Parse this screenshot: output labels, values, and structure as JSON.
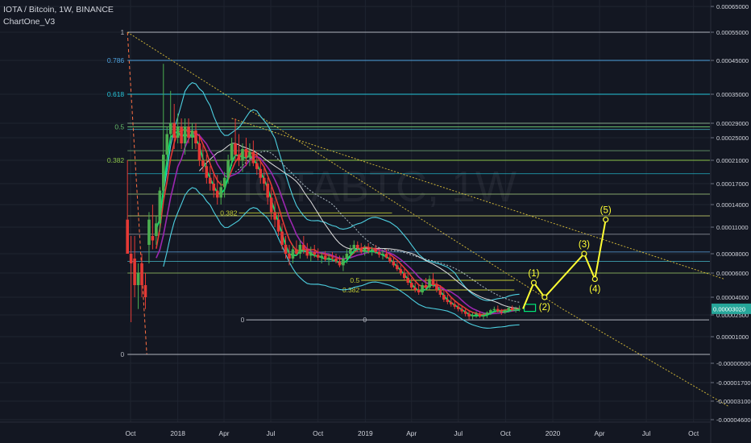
{
  "header": {
    "title": "IOTA / Bitcoin, 1W, BINANCE",
    "indicator": "ChartOne_V3"
  },
  "watermark": "IOTABTC, 1W",
  "price_marker": "0.00003020",
  "colors": {
    "background": "#131722",
    "grid": "#1f2430",
    "up": "#4caf50",
    "down": "#e53935",
    "wave": "#ffff33",
    "price_marker": "#26a69a"
  },
  "chart_data": {
    "type": "candlestick",
    "x_tick_labels": [
      "Oct",
      "2018",
      "Apr",
      "Jul",
      "Oct",
      "2019",
      "Apr",
      "Jul",
      "Oct",
      "2020",
      "Apr",
      "Jul",
      "Oct"
    ],
    "y_tick_labels": [
      "0.00065000",
      "0.00055000",
      "0.00045000",
      "0.00035000",
      "0.00029000",
      "0.00025000",
      "0.00021000",
      "0.00017000",
      "0.00014000",
      "0.00011000",
      "0.00008000",
      "0.00006000",
      "0.00004000",
      "0.00002500",
      "0.00001000",
      "-0.00000500",
      "-0.00001700",
      "-0.00003100",
      "-0.00004600"
    ],
    "y_tick_values": [
      0.00065,
      0.00055,
      0.00045,
      0.00035,
      0.00029,
      0.00025,
      0.00021,
      0.00017,
      0.00014,
      0.00011,
      8e-05,
      6e-05,
      4e-05,
      2.5e-05,
      1e-05,
      -5e-06,
      -1.7e-05,
      -3.1e-05,
      -4.6e-05
    ],
    "candles": [
      {
        "t": "2017-09-25",
        "o": 0.00012,
        "h": 0.00021,
        "l": 8e-05,
        "c": 8e-05
      },
      {
        "t": "2017-10-02",
        "o": 8e-05,
        "h": 0.0001,
        "l": 2e-05,
        "c": 7e-05
      },
      {
        "t": "2017-10-09",
        "o": 7.5e-05,
        "h": 0.0001,
        "l": 4e-05,
        "c": 5e-05
      },
      {
        "t": "2017-10-16",
        "o": 5e-05,
        "h": 7e-05,
        "l": 3e-05,
        "c": 6e-05
      },
      {
        "t": "2017-10-23",
        "o": 7e-05,
        "h": 8e-05,
        "l": 4e-05,
        "c": 5e-05
      },
      {
        "t": "2017-10-30",
        "o": 5e-05,
        "h": 6e-05,
        "l": 3e-05,
        "c": 4e-05
      },
      {
        "t": "2017-11-06",
        "o": 9e-05,
        "h": 0.00013,
        "l": 7e-05,
        "c": 0.00012
      },
      {
        "t": "2017-11-13",
        "o": 0.0001,
        "h": 0.00014,
        "l": 8.5e-05,
        "c": 9.5e-05
      },
      {
        "t": "2017-11-20",
        "o": 0.0001,
        "h": 0.000125,
        "l": 9e-05,
        "c": 0.000115
      },
      {
        "t": "2017-11-27",
        "o": 0.000115,
        "h": 0.000165,
        "l": 0.000105,
        "c": 0.00016
      },
      {
        "t": "2017-12-04",
        "o": 0.00016,
        "h": 0.00044,
        "l": 0.00015,
        "c": 0.00022
      },
      {
        "t": "2017-12-11",
        "o": 0.00022,
        "h": 0.00028,
        "l": 0.0002,
        "c": 0.00026
      },
      {
        "t": "2017-12-18",
        "o": 0.00026,
        "h": 0.00036,
        "l": 0.00024,
        "c": 0.00029
      },
      {
        "t": "2017-12-25",
        "o": 0.00029,
        "h": 0.00033,
        "l": 0.00023,
        "c": 0.00025
      },
      {
        "t": "2018-01-01",
        "o": 0.00025,
        "h": 0.00031,
        "l": 0.00024,
        "c": 0.00028
      },
      {
        "t": "2018-01-08",
        "o": 0.00028,
        "h": 0.0003,
        "l": 0.00023,
        "c": 0.00024
      },
      {
        "t": "2018-01-15",
        "o": 0.00024,
        "h": 0.0003,
        "l": 0.00022,
        "c": 0.00028
      },
      {
        "t": "2018-01-22",
        "o": 0.00028,
        "h": 0.0003,
        "l": 0.00024,
        "c": 0.00025
      },
      {
        "t": "2018-01-29",
        "o": 0.00025,
        "h": 0.00029,
        "l": 0.00023,
        "c": 0.00027
      },
      {
        "t": "2018-02-05",
        "o": 0.00027,
        "h": 0.00029,
        "l": 0.00023,
        "c": 0.00024
      },
      {
        "t": "2018-02-12",
        "o": 0.00024,
        "h": 0.00026,
        "l": 0.0002,
        "c": 0.00021
      },
      {
        "t": "2018-02-19",
        "o": 0.00021,
        "h": 0.00024,
        "l": 0.00019,
        "c": 0.0002
      },
      {
        "t": "2018-02-26",
        "o": 0.0002,
        "h": 0.00022,
        "l": 0.00017,
        "c": 0.00018
      },
      {
        "t": "2018-03-05",
        "o": 0.00018,
        "h": 0.0002,
        "l": 0.00016,
        "c": 0.00017
      },
      {
        "t": "2018-03-12",
        "o": 0.00017,
        "h": 0.00019,
        "l": 0.00015,
        "c": 0.00016
      },
      {
        "t": "2018-03-19",
        "o": 0.00016,
        "h": 0.000185,
        "l": 0.00014,
        "c": 0.00015
      },
      {
        "t": "2018-03-26",
        "o": 0.00015,
        "h": 0.000175,
        "l": 0.00014,
        "c": 0.000165
      },
      {
        "t": "2018-04-02",
        "o": 0.000165,
        "h": 0.00019,
        "l": 0.00015,
        "c": 0.00018
      },
      {
        "t": "2018-04-09",
        "o": 0.00018,
        "h": 0.00022,
        "l": 0.00017,
        "c": 0.00021
      },
      {
        "t": "2018-04-16",
        "o": 0.00021,
        "h": 0.00025,
        "l": 0.0002,
        "c": 0.00024
      },
      {
        "t": "2018-04-23",
        "o": 0.00024,
        "h": 0.0003,
        "l": 0.00021,
        "c": 0.00022
      },
      {
        "t": "2018-04-30",
        "o": 0.00022,
        "h": 0.00026,
        "l": 0.0002,
        "c": 0.00021
      },
      {
        "t": "2018-05-07",
        "o": 0.00021,
        "h": 0.00024,
        "l": 0.00019,
        "c": 0.00023
      },
      {
        "t": "2018-05-14",
        "o": 0.00023,
        "h": 0.00025,
        "l": 0.0002,
        "c": 0.000215
      },
      {
        "t": "2018-05-21",
        "o": 0.000215,
        "h": 0.00024,
        "l": 0.0002,
        "c": 0.000225
      },
      {
        "t": "2018-05-28",
        "o": 0.000225,
        "h": 0.000245,
        "l": 0.0002,
        "c": 0.000205
      },
      {
        "t": "2018-06-04",
        "o": 0.000205,
        "h": 0.000225,
        "l": 0.000185,
        "c": 0.000195
      },
      {
        "t": "2018-06-11",
        "o": 0.000195,
        "h": 0.00021,
        "l": 0.00017,
        "c": 0.00018
      },
      {
        "t": "2018-06-18",
        "o": 0.00018,
        "h": 0.0002,
        "l": 0.00016,
        "c": 0.00017
      },
      {
        "t": "2018-06-25",
        "o": 0.00017,
        "h": 0.00018,
        "l": 0.00014,
        "c": 0.00015
      },
      {
        "t": "2018-07-02",
        "o": 0.00015,
        "h": 0.000165,
        "l": 0.00012,
        "c": 0.00013
      },
      {
        "t": "2018-07-09",
        "o": 0.00013,
        "h": 0.000145,
        "l": 0.00011,
        "c": 0.00012
      },
      {
        "t": "2018-07-16",
        "o": 0.00012,
        "h": 0.00013,
        "l": 0.0001,
        "c": 0.000105
      },
      {
        "t": "2018-07-23",
        "o": 0.000105,
        "h": 0.000115,
        "l": 8.5e-05,
        "c": 9e-05
      },
      {
        "t": "2018-07-30",
        "o": 9e-05,
        "h": 0.0001,
        "l": 7.5e-05,
        "c": 8e-05
      },
      {
        "t": "2018-08-06",
        "o": 8e-05,
        "h": 9e-05,
        "l": 6.8e-05,
        "c": 7.5e-05
      },
      {
        "t": "2018-08-13",
        "o": 7.5e-05,
        "h": 9e-05,
        "l": 7e-05,
        "c": 8.5e-05
      },
      {
        "t": "2018-08-20",
        "o": 8.5e-05,
        "h": 9.5e-05,
        "l": 7.8e-05,
        "c": 8e-05
      },
      {
        "t": "2018-08-27",
        "o": 8e-05,
        "h": 9.5e-05,
        "l": 7.5e-05,
        "c": 9e-05
      },
      {
        "t": "2018-09-03",
        "o": 9e-05,
        "h": 0.0001,
        "l": 8e-05,
        "c": 8.5e-05
      },
      {
        "t": "2018-09-10",
        "o": 8.5e-05,
        "h": 9.2e-05,
        "l": 7.5e-05,
        "c": 7.8e-05
      },
      {
        "t": "2018-09-17",
        "o": 7.8e-05,
        "h": 8.8e-05,
        "l": 7.2e-05,
        "c": 8.2e-05
      },
      {
        "t": "2018-09-24",
        "o": 8.2e-05,
        "h": 9e-05,
        "l": 7.6e-05,
        "c": 7.9e-05
      },
      {
        "t": "2018-10-01",
        "o": 7.9e-05,
        "h": 8.6e-05,
        "l": 7.3e-05,
        "c": 7.6e-05
      },
      {
        "t": "2018-10-08",
        "o": 7.6e-05,
        "h": 8.2e-05,
        "l": 7e-05,
        "c": 7.8e-05
      },
      {
        "t": "2018-10-15",
        "o": 7.8e-05,
        "h": 8.3e-05,
        "l": 7.2e-05,
        "c": 7.4e-05
      },
      {
        "t": "2018-10-22",
        "o": 7.4e-05,
        "h": 8e-05,
        "l": 6.8e-05,
        "c": 7.6e-05
      },
      {
        "t": "2018-10-29",
        "o": 7.6e-05,
        "h": 8.2e-05,
        "l": 7.2e-05,
        "c": 7.5e-05
      },
      {
        "t": "2018-11-05",
        "o": 7.5e-05,
        "h": 8e-05,
        "l": 7e-05,
        "c": 7.2e-05
      },
      {
        "t": "2018-11-12",
        "o": 7.2e-05,
        "h": 7.8e-05,
        "l": 6.6e-05,
        "c": 6.8e-05
      },
      {
        "t": "2018-11-19",
        "o": 6.8e-05,
        "h": 7.8e-05,
        "l": 6.2e-05,
        "c": 7.5e-05
      },
      {
        "t": "2018-11-26",
        "o": 7.5e-05,
        "h": 8.5e-05,
        "l": 7e-05,
        "c": 8e-05
      },
      {
        "t": "2018-12-03",
        "o": 8e-05,
        "h": 9e-05,
        "l": 7.5e-05,
        "c": 8.5e-05
      },
      {
        "t": "2018-12-10",
        "o": 8.5e-05,
        "h": 9.5e-05,
        "l": 8e-05,
        "c": 9e-05
      },
      {
        "t": "2018-12-17",
        "o": 9e-05,
        "h": 9.4e-05,
        "l": 8.2e-05,
        "c": 8.6e-05
      },
      {
        "t": "2018-12-24",
        "o": 8.6e-05,
        "h": 9.2e-05,
        "l": 8e-05,
        "c": 8.2e-05
      },
      {
        "t": "2018-12-31",
        "o": 8.2e-05,
        "h": 9e-05,
        "l": 7.8e-05,
        "c": 8.6e-05
      },
      {
        "t": "2019-01-07",
        "o": 8.6e-05,
        "h": 9.2e-05,
        "l": 8e-05,
        "c": 8.3e-05
      },
      {
        "t": "2019-01-14",
        "o": 8.3e-05,
        "h": 8.8e-05,
        "l": 7.8e-05,
        "c": 8.5e-05
      },
      {
        "t": "2019-01-21",
        "o": 8.5e-05,
        "h": 9e-05,
        "l": 8e-05,
        "c": 8.2e-05
      },
      {
        "t": "2019-01-28",
        "o": 8.2e-05,
        "h": 8.6e-05,
        "l": 7.6e-05,
        "c": 7.9e-05
      },
      {
        "t": "2019-02-04",
        "o": 7.9e-05,
        "h": 8.4e-05,
        "l": 7.4e-05,
        "c": 8e-05
      },
      {
        "t": "2019-02-11",
        "o": 8e-05,
        "h": 8.5e-05,
        "l": 7.5e-05,
        "c": 7.6e-05
      },
      {
        "t": "2019-02-18",
        "o": 7.6e-05,
        "h": 8e-05,
        "l": 7e-05,
        "c": 7.2e-05
      },
      {
        "t": "2019-02-25",
        "o": 7.2e-05,
        "h": 7.6e-05,
        "l": 6.6e-05,
        "c": 6.8e-05
      },
      {
        "t": "2019-03-04",
        "o": 6.8e-05,
        "h": 7.2e-05,
        "l": 6.2e-05,
        "c": 6.4e-05
      },
      {
        "t": "2019-03-11",
        "o": 6.4e-05,
        "h": 6.8e-05,
        "l": 5.8e-05,
        "c": 6e-05
      },
      {
        "t": "2019-03-18",
        "o": 6e-05,
        "h": 6.4e-05,
        "l": 5.4e-05,
        "c": 5.6e-05
      },
      {
        "t": "2019-03-25",
        "o": 5.6e-05,
        "h": 6e-05,
        "l": 5e-05,
        "c": 5.2e-05
      },
      {
        "t": "2019-04-01",
        "o": 5.2e-05,
        "h": 5.6e-05,
        "l": 4.6e-05,
        "c": 4.8e-05
      },
      {
        "t": "2019-04-08",
        "o": 4.8e-05,
        "h": 5.2e-05,
        "l": 4.4e-05,
        "c": 4.6e-05
      },
      {
        "t": "2019-04-15",
        "o": 4.6e-05,
        "h": 5e-05,
        "l": 4.2e-05,
        "c": 4.4e-05
      },
      {
        "t": "2019-04-22",
        "o": 4.4e-05,
        "h": 5.2e-05,
        "l": 4.2e-05,
        "c": 5e-05
      },
      {
        "t": "2019-04-29",
        "o": 5e-05,
        "h": 5.6e-05,
        "l": 4.6e-05,
        "c": 4.8e-05
      },
      {
        "t": "2019-05-06",
        "o": 4.8e-05,
        "h": 5.8e-05,
        "l": 4.6e-05,
        "c": 5.5e-05
      },
      {
        "t": "2019-05-13",
        "o": 5.5e-05,
        "h": 6e-05,
        "l": 4.8e-05,
        "c": 5e-05
      },
      {
        "t": "2019-05-20",
        "o": 5e-05,
        "h": 5.4e-05,
        "l": 4.4e-05,
        "c": 4.6e-05
      },
      {
        "t": "2019-05-27",
        "o": 4.6e-05,
        "h": 5e-05,
        "l": 4e-05,
        "c": 4.2e-05
      },
      {
        "t": "2019-06-03",
        "o": 4.2e-05,
        "h": 4.6e-05,
        "l": 3.6e-05,
        "c": 3.8e-05
      },
      {
        "t": "2019-06-10",
        "o": 3.8e-05,
        "h": 4.2e-05,
        "l": 3.4e-05,
        "c": 3.6e-05
      },
      {
        "t": "2019-06-17",
        "o": 3.6e-05,
        "h": 4e-05,
        "l": 3.2e-05,
        "c": 3.4e-05
      },
      {
        "t": "2019-06-24",
        "o": 3.4e-05,
        "h": 3.7e-05,
        "l": 3e-05,
        "c": 3.2e-05
      },
      {
        "t": "2019-07-01",
        "o": 3.2e-05,
        "h": 3.5e-05,
        "l": 2.8e-05,
        "c": 3e-05
      },
      {
        "t": "2019-07-08",
        "o": 3e-05,
        "h": 3.3e-05,
        "l": 2.6e-05,
        "c": 2.8e-05
      },
      {
        "t": "2019-07-15",
        "o": 2.8e-05,
        "h": 3.1e-05,
        "l": 2.4e-05,
        "c": 2.6e-05
      },
      {
        "t": "2019-07-22",
        "o": 2.6e-05,
        "h": 2.8e-05,
        "l": 2.2e-05,
        "c": 2.4e-05
      },
      {
        "t": "2019-07-29",
        "o": 2.4e-05,
        "h": 2.7e-05,
        "l": 2.2e-05,
        "c": 2.5e-05
      },
      {
        "t": "2019-08-05",
        "o": 2.5e-05,
        "h": 2.8e-05,
        "l": 2.3e-05,
        "c": 2.6e-05
      },
      {
        "t": "2019-08-12",
        "o": 2.6e-05,
        "h": 2.8e-05,
        "l": 2.3e-05,
        "c": 2.4e-05
      },
      {
        "t": "2019-08-19",
        "o": 2.4e-05,
        "h": 2.7e-05,
        "l": 2.2e-05,
        "c": 2.5e-05
      },
      {
        "t": "2019-08-26",
        "o": 2.5e-05,
        "h": 2.8e-05,
        "l": 2.3e-05,
        "c": 2.7e-05
      },
      {
        "t": "2019-09-02",
        "o": 2.7e-05,
        "h": 3e-05,
        "l": 2.5e-05,
        "c": 2.9e-05
      },
      {
        "t": "2019-09-09",
        "o": 2.9e-05,
        "h": 3.2e-05,
        "l": 2.7e-05,
        "c": 3e-05
      },
      {
        "t": "2019-09-16",
        "o": 3e-05,
        "h": 3.3e-05,
        "l": 2.7e-05,
        "c": 2.8e-05
      },
      {
        "t": "2019-09-23",
        "o": 2.8e-05,
        "h": 3e-05,
        "l": 2.5e-05,
        "c": 2.7e-05
      },
      {
        "t": "2019-09-30",
        "o": 2.7e-05,
        "h": 3e-05,
        "l": 2.6e-05,
        "c": 2.9e-05
      },
      {
        "t": "2019-10-07",
        "o": 2.9e-05,
        "h": 3.2e-05,
        "l": 2.7e-05,
        "c": 3.1e-05
      },
      {
        "t": "2019-10-14",
        "o": 3.1e-05,
        "h": 3.3e-05,
        "l": 2.8e-05,
        "c": 2.9e-05
      },
      {
        "t": "2019-10-21",
        "o": 2.9e-05,
        "h": 3.2e-05,
        "l": 2.7e-05,
        "c": 3e-05
      },
      {
        "t": "2019-10-28",
        "o": 3e-05,
        "h": 3.3e-05,
        "l": 2.8e-05,
        "c": 3.02e-05
      }
    ],
    "fib_levels": [
      {
        "label": "1",
        "value": 0.00055,
        "color": "#b2b5be"
      },
      {
        "label": "0.786",
        "value": 0.00045,
        "color": "#4fa3e0"
      },
      {
        "label": "0.618",
        "value": 0.00035,
        "color": "#26c6da"
      },
      {
        "label": "0.5",
        "value": 0.00028,
        "color": "#66bb6a"
      },
      {
        "label": "0.382",
        "value": 0.00021,
        "color": "#8bc34a"
      },
      {
        "label": "0",
        "value": 0.0,
        "color": "#b2b5be"
      }
    ],
    "fib_levels_small": [
      {
        "label": "0.382",
        "value": 0.000129,
        "color": "#c0ca33"
      },
      {
        "label": "0.382",
        "value": 4.6e-05,
        "color": "#c0ca33"
      },
      {
        "label": "0.5",
        "value": 5.4e-05,
        "color": "#c0ca33"
      }
    ],
    "zero_lines": [
      {
        "label": "0",
        "value": 2.16e-05
      }
    ],
    "horizontal_levels": [
      0.00029,
      0.000273,
      0.000227,
      0.000187,
      0.000155,
      0.000125,
      0.000102,
      8.2e-05,
      7.2e-05,
      6e-05
    ],
    "elliott_projection": [
      {
        "label": "",
        "t": "2019-11-04",
        "v": 3.02e-05
      },
      {
        "label": "(1)",
        "t": "2019-11-25",
        "v": 5.2e-05
      },
      {
        "label": "(2)",
        "t": "2019-12-16",
        "v": 4e-05
      },
      {
        "label": "(3)",
        "t": "2020-03-02",
        "v": 8e-05
      },
      {
        "label": "(4)",
        "t": "2020-03-23",
        "v": 5.5e-05
      },
      {
        "label": "(5)",
        "t": "2020-04-13",
        "v": 0.00012
      }
    ],
    "trendlines": [
      {
        "from": {
          "t": "2017-09-25",
          "v": 0.00055
        },
        "to": {
          "t": "2020-01-20",
          "v": 3e-05
        }
      },
      {
        "from": {
          "t": "2018-04-16",
          "v": 0.0003
        },
        "to": {
          "t": "2020-11-30",
          "v": 5.5e-05
        }
      },
      {
        "from": {
          "t": "2020-01-20",
          "v": 3e-05
        },
        "to": {
          "t": "2020-12-07",
          "v": -3.5e-05
        }
      }
    ],
    "price_current": 3.02e-05
  }
}
